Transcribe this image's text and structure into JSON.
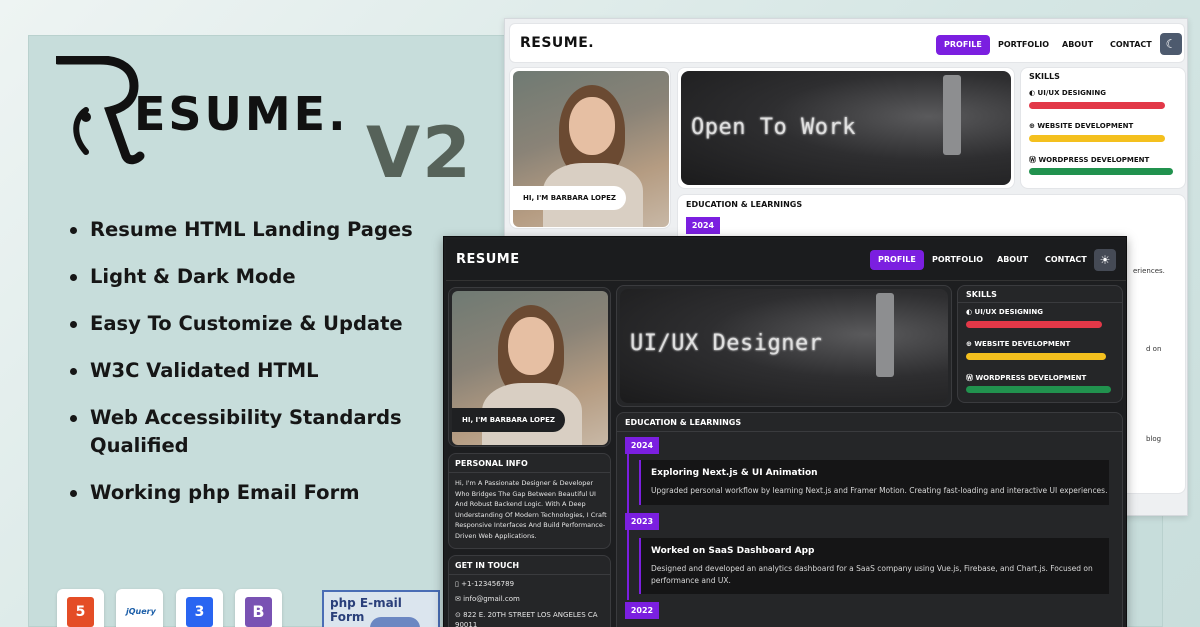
{
  "brand": {
    "logo_text": "RESUME.",
    "version": "V2"
  },
  "features": [
    "Resume HTML Landing Pages",
    "Light & Dark Mode",
    "Easy To Customize & Update",
    "W3C Validated HTML",
    "Web Accessibility Standards Qualified",
    "Working php Email Form"
  ],
  "tech_icons": [
    "html5-icon",
    "jquery-icon",
    "css3-icon",
    "bootstrap-icon"
  ],
  "tech_labels": {
    "jquery": "jQuery",
    "bootstrap": "B"
  },
  "php_box": {
    "label": "php E-mail Form"
  },
  "colors": {
    "accent": "#7b1fe0",
    "skill_red": "#e23848",
    "skill_yellow": "#f4c01e",
    "skill_green": "#21924e"
  },
  "light": {
    "logo": "RESUME.",
    "nav": {
      "profile": "PROFILE",
      "portfolio": "PORTFOLIO",
      "about": "ABOUT",
      "contact": "CONTACT",
      "mode_icon": "moon-icon"
    },
    "name_pill": "HI, I'M BARBARA LOPEZ",
    "hero_text": "Open To Work",
    "skills_title": "SKILLS",
    "skills": [
      {
        "label": "UI/UX DESIGNING",
        "icon": "palette-icon",
        "level": 0.97
      },
      {
        "label": "WEBSITE DEVELOPMENT",
        "icon": "globe-icon",
        "level": 0.97
      },
      {
        "label": "WORDPRESS DEVELOPMENT",
        "icon": "wordpress-icon",
        "level": 0.99
      }
    ],
    "edu_title": "EDUCATION & LEARNINGS",
    "year": "2024",
    "fragments": [
      "eriences.",
      "d on",
      "blog"
    ]
  },
  "dark": {
    "logo": "RESUME",
    "nav": {
      "profile": "PROFILE",
      "portfolio": "PORTFOLIO",
      "about": "ABOUT",
      "contact": "CONTACT",
      "mode_icon": "sun-icon"
    },
    "name_pill": "HI, I'M BARBARA LOPEZ",
    "hero_text": "UI/UX Designer",
    "skills_title": "SKILLS",
    "skills": [
      {
        "label": "UI/UX DESIGNING",
        "icon": "palette-icon",
        "level": 0.94
      },
      {
        "label": "WEBSITE DEVELOPMENT",
        "icon": "globe-icon",
        "level": 0.96
      },
      {
        "label": "WORDPRESS DEVELOPMENT",
        "icon": "wordpress-icon",
        "level": 0.97
      }
    ],
    "personal_title": "PERSONAL INFO",
    "personal_text": "Hi, I'm A Passionate Designer & Developer Who Bridges The Gap Between Beautiful UI And Robust Backend Logic. With A Deep Understanding Of Modern Technologies, I Craft Responsive Interfaces And Build Performance-Driven Web Applications.",
    "contact_title": "GET IN TOUCH",
    "contact": {
      "phone": "+1-123456789",
      "email": "info@gmail.com",
      "address": "822 E. 20TH STREET LOS ANGELES CA 90011"
    },
    "edu_title": "EDUCATION & LEARNINGS",
    "timeline": [
      {
        "year": "2024",
        "title": "Exploring Next.js & UI Animation",
        "desc": "Upgraded personal workflow by learning Next.js and Framer Motion. Creating fast-loading and interactive UI experiences."
      },
      {
        "year": "2023",
        "title": "Worked on SaaS Dashboard App",
        "desc": "Designed and developed an analytics dashboard for a SaaS company using Vue.js, Firebase, and Chart.js. Focused on performance and UX."
      },
      {
        "year": "2022"
      }
    ]
  }
}
